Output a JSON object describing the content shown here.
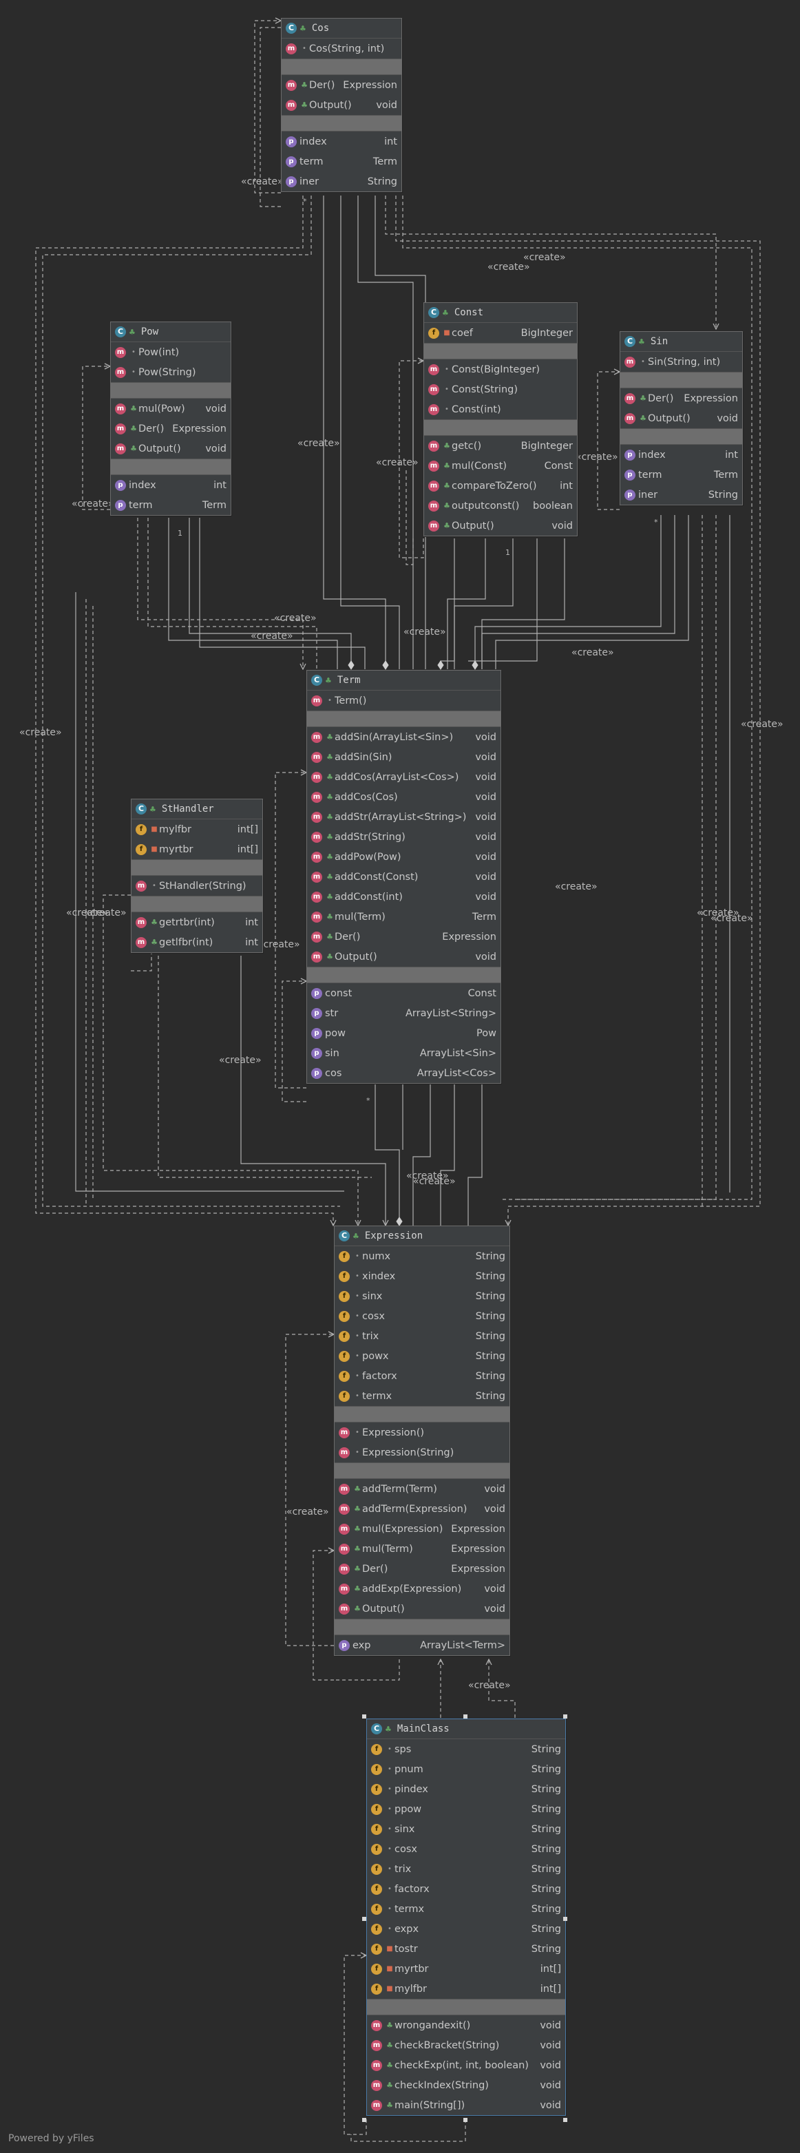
{
  "footer": "Powered by yFiles",
  "edge_label": "«create»",
  "classes": {
    "cos": {
      "name": "Cos",
      "ctors": [
        {
          "name": "Cos(String, int)"
        }
      ],
      "methods": [
        {
          "name": "Der()",
          "type": "Expression"
        },
        {
          "name": "Output()",
          "type": "void"
        }
      ],
      "props": [
        {
          "name": "index",
          "type": "int"
        },
        {
          "name": "term",
          "type": "Term"
        },
        {
          "name": "iner",
          "type": "String"
        }
      ]
    },
    "pow": {
      "name": "Pow",
      "ctors": [
        {
          "name": "Pow(int)"
        },
        {
          "name": "Pow(String)"
        }
      ],
      "methods": [
        {
          "name": "mul(Pow)",
          "type": "void"
        },
        {
          "name": "Der()",
          "type": "Expression"
        },
        {
          "name": "Output()",
          "type": "void"
        }
      ],
      "props": [
        {
          "name": "index",
          "type": "int"
        },
        {
          "name": "term",
          "type": "Term"
        }
      ]
    },
    "const": {
      "name": "Const",
      "fields": [
        {
          "name": "coef",
          "type": "BigInteger"
        }
      ],
      "ctors": [
        {
          "name": "Const(BigInteger)"
        },
        {
          "name": "Const(String)"
        },
        {
          "name": "Const(int)"
        }
      ],
      "methods": [
        {
          "name": "getc()",
          "type": "BigInteger"
        },
        {
          "name": "mul(Const)",
          "type": "Const"
        },
        {
          "name": "compareToZero()",
          "type": "int"
        },
        {
          "name": "outputconst()",
          "type": "boolean"
        },
        {
          "name": "Output()",
          "type": "void"
        }
      ]
    },
    "sin": {
      "name": "Sin",
      "ctors": [
        {
          "name": "Sin(String, int)"
        }
      ],
      "methods": [
        {
          "name": "Der()",
          "type": "Expression"
        },
        {
          "name": "Output()",
          "type": "void"
        }
      ],
      "props": [
        {
          "name": "index",
          "type": "int"
        },
        {
          "name": "term",
          "type": "Term"
        },
        {
          "name": "iner",
          "type": "String"
        }
      ]
    },
    "term": {
      "name": "Term",
      "ctors": [
        {
          "name": "Term()"
        }
      ],
      "methods": [
        {
          "name": "addSin(ArrayList<Sin>)",
          "type": "void"
        },
        {
          "name": "addSin(Sin)",
          "type": "void"
        },
        {
          "name": "addCos(ArrayList<Cos>)",
          "type": "void"
        },
        {
          "name": "addCos(Cos)",
          "type": "void"
        },
        {
          "name": "addStr(ArrayList<String>)",
          "type": "void"
        },
        {
          "name": "addStr(String)",
          "type": "void"
        },
        {
          "name": "addPow(Pow)",
          "type": "void"
        },
        {
          "name": "addConst(Const)",
          "type": "void"
        },
        {
          "name": "addConst(int)",
          "type": "void"
        },
        {
          "name": "mul(Term)",
          "type": "Term"
        },
        {
          "name": "Der()",
          "type": "Expression"
        },
        {
          "name": "Output()",
          "type": "void"
        }
      ],
      "props": [
        {
          "name": "const",
          "type": "Const"
        },
        {
          "name": "str",
          "type": "ArrayList<String>"
        },
        {
          "name": "pow",
          "type": "Pow"
        },
        {
          "name": "sin",
          "type": "ArrayList<Sin>"
        },
        {
          "name": "cos",
          "type": "ArrayList<Cos>"
        }
      ]
    },
    "sthandler": {
      "name": "StHandler",
      "fields": [
        {
          "name": "mylfbr",
          "type": "int[]"
        },
        {
          "name": "myrtbr",
          "type": "int[]"
        }
      ],
      "ctors": [
        {
          "name": "StHandler(String)"
        }
      ],
      "methods": [
        {
          "name": "getrtbr(int)",
          "type": "int"
        },
        {
          "name": "getlfbr(int)",
          "type": "int"
        }
      ]
    },
    "expression": {
      "name": "Expression",
      "fields": [
        {
          "name": "numx",
          "type": "String"
        },
        {
          "name": "xindex",
          "type": "String"
        },
        {
          "name": "sinx",
          "type": "String"
        },
        {
          "name": "cosx",
          "type": "String"
        },
        {
          "name": "trix",
          "type": "String"
        },
        {
          "name": "powx",
          "type": "String"
        },
        {
          "name": "factorx",
          "type": "String"
        },
        {
          "name": "termx",
          "type": "String"
        }
      ],
      "ctors": [
        {
          "name": "Expression()"
        },
        {
          "name": "Expression(String)"
        }
      ],
      "methods": [
        {
          "name": "addTerm(Term)",
          "type": "void"
        },
        {
          "name": "addTerm(Expression)",
          "type": "void"
        },
        {
          "name": "mul(Expression)",
          "type": "Expression"
        },
        {
          "name": "mul(Term)",
          "type": "Expression"
        },
        {
          "name": "Der()",
          "type": "Expression"
        },
        {
          "name": "addExp(Expression)",
          "type": "void"
        },
        {
          "name": "Output()",
          "type": "void"
        }
      ],
      "props": [
        {
          "name": "exp",
          "type": "ArrayList<Term>"
        }
      ]
    },
    "mainclass": {
      "name": "MainClass",
      "fields": [
        {
          "name": "sps",
          "type": "String"
        },
        {
          "name": "pnum",
          "type": "String"
        },
        {
          "name": "pindex",
          "type": "String"
        },
        {
          "name": "ppow",
          "type": "String"
        },
        {
          "name": "sinx",
          "type": "String"
        },
        {
          "name": "cosx",
          "type": "String"
        },
        {
          "name": "trix",
          "type": "String"
        },
        {
          "name": "factorx",
          "type": "String"
        },
        {
          "name": "termx",
          "type": "String"
        },
        {
          "name": "expx",
          "type": "String"
        },
        {
          "name": "tostr",
          "type": "String"
        },
        {
          "name": "myrtbr",
          "type": "int[]"
        },
        {
          "name": "mylfbr",
          "type": "int[]"
        }
      ],
      "methods": [
        {
          "name": "wrongandexit()",
          "type": "void"
        },
        {
          "name": "checkBracket(String)",
          "type": "void"
        },
        {
          "name": "checkExp(int, int, boolean)",
          "type": "void"
        },
        {
          "name": "checkIndex(String)",
          "type": "void"
        },
        {
          "name": "main(String[])",
          "type": "void"
        }
      ]
    }
  },
  "multiplicity": {
    "star": "*",
    "one": "1"
  },
  "colors": {
    "background": "#2b2b2b",
    "box": "#3c3f41",
    "separator": "#6e6e6e",
    "edge": "#b0b0b0",
    "method_icon": "#c94f6d",
    "property_icon": "#8a6fbd",
    "field_icon": "#d6a13a",
    "class_icon": "#3e86a0",
    "selected_border": "#4a7aa8"
  }
}
